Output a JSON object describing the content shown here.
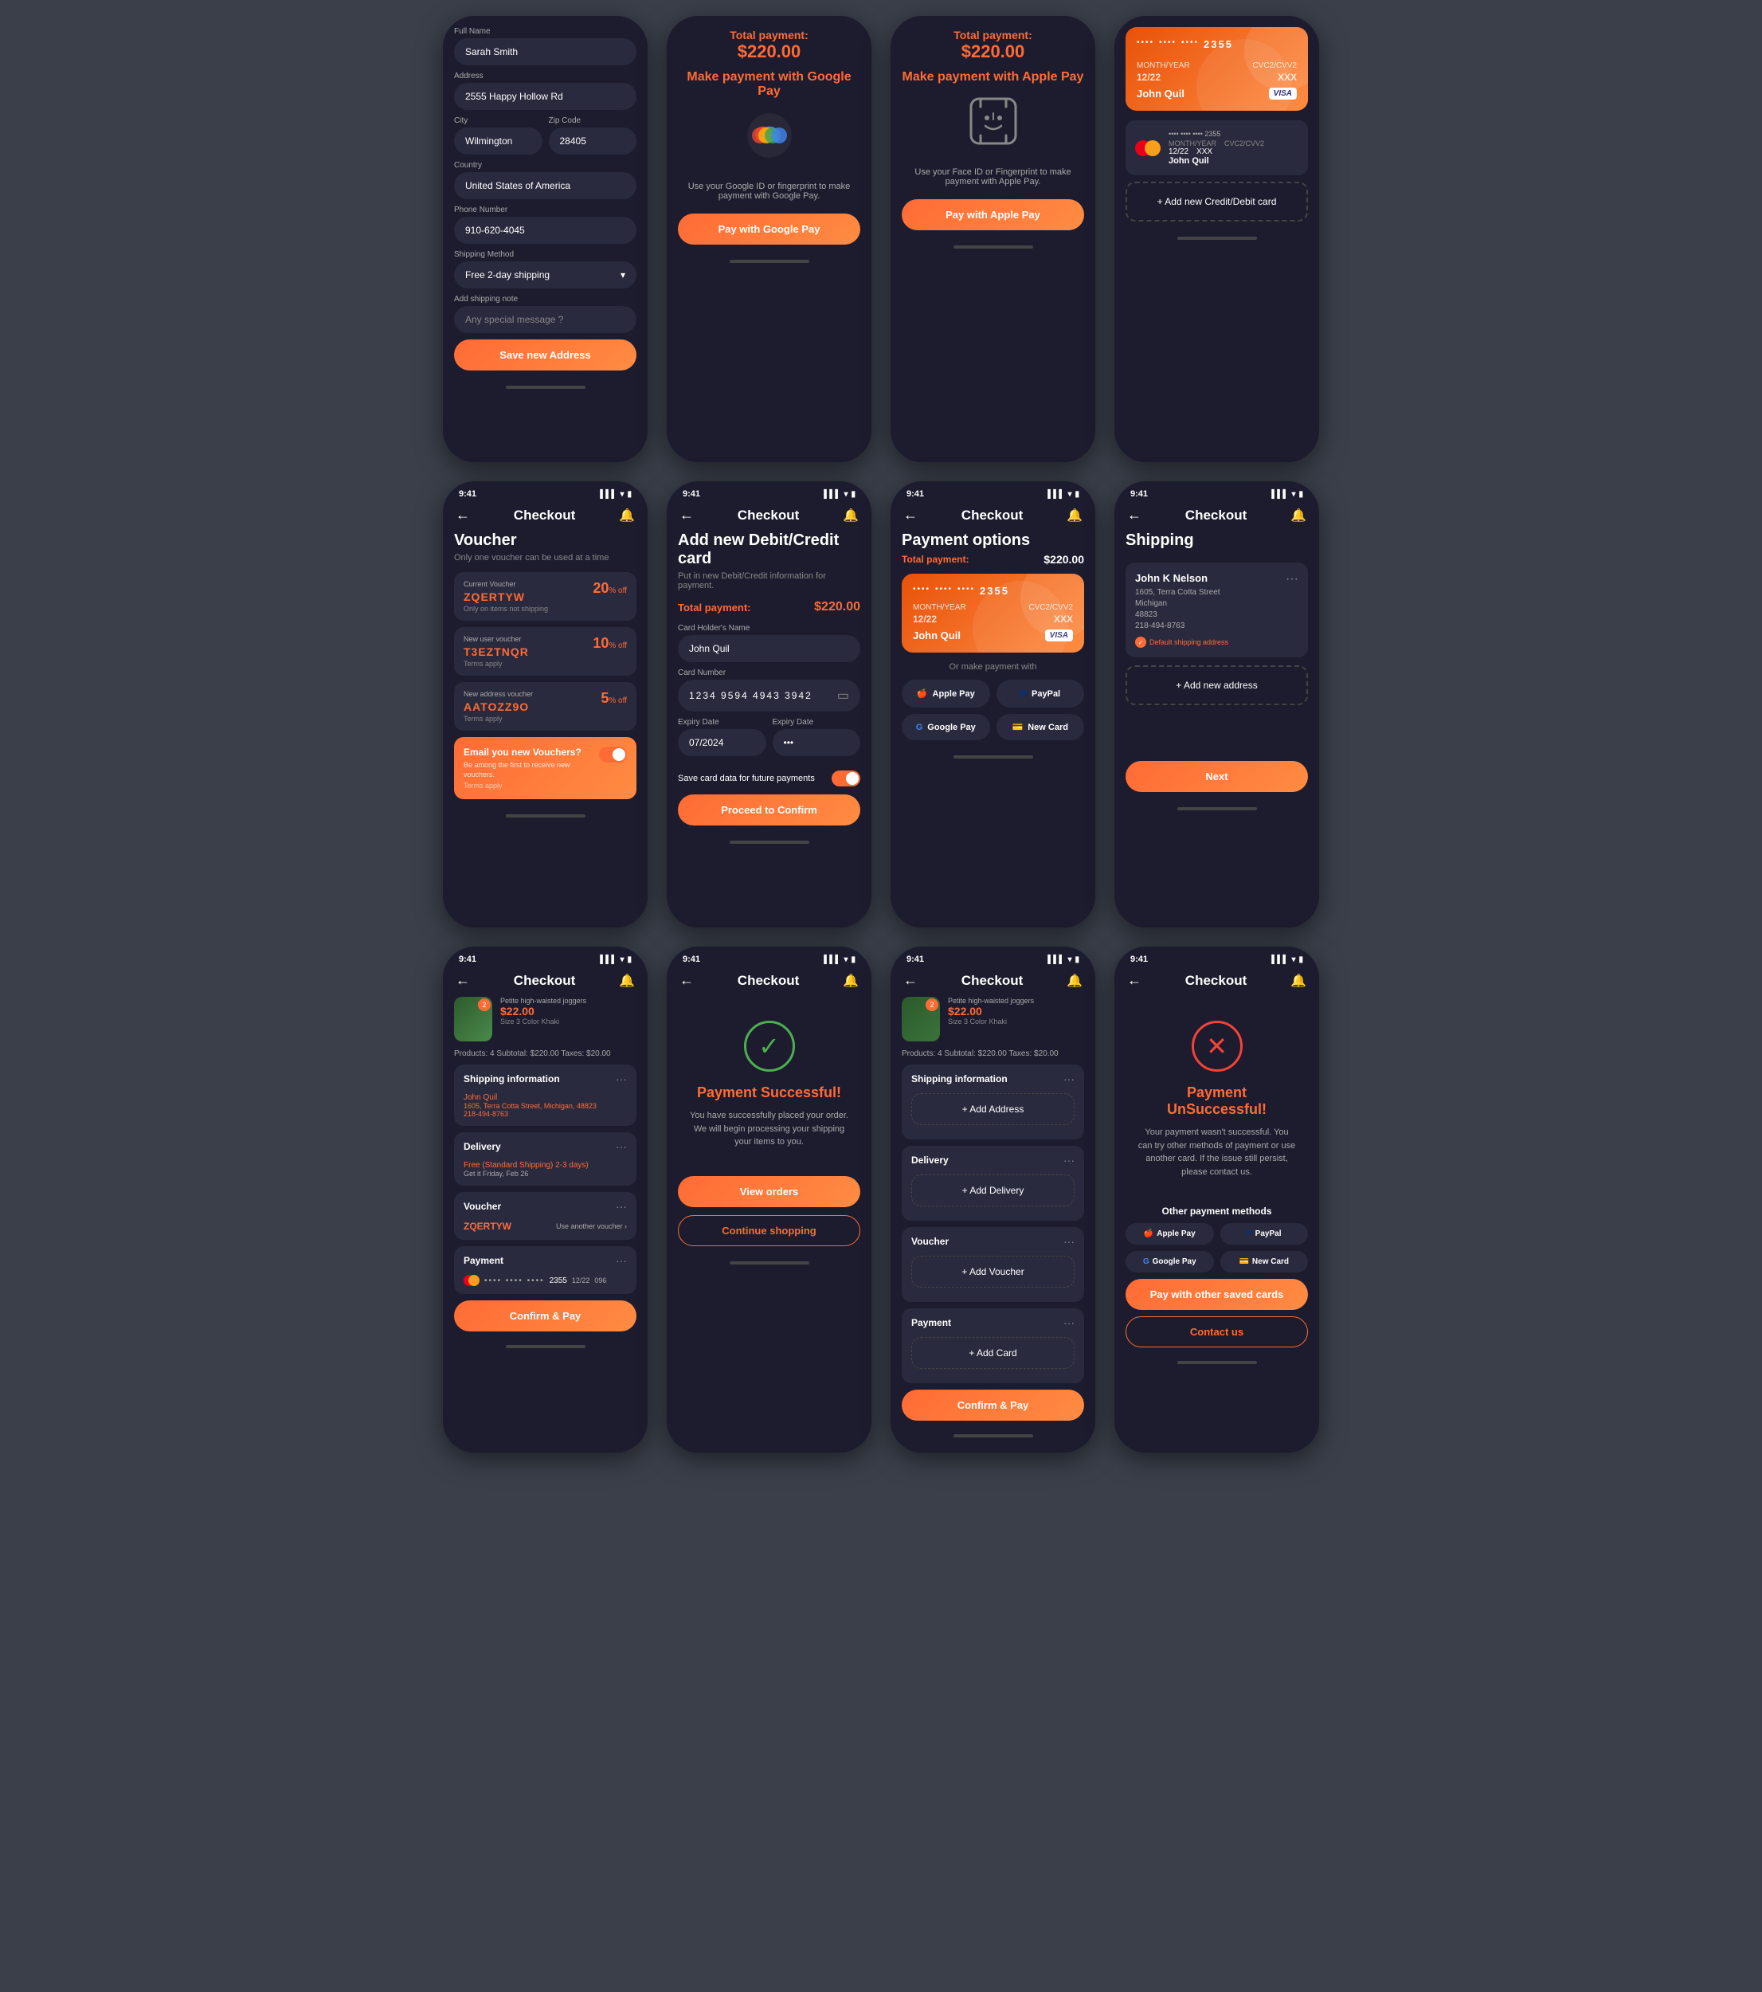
{
  "phones": [
    {
      "id": "shipping-address",
      "title": "",
      "hasStatusBar": false,
      "hasNav": false,
      "type": "shipping-form"
    },
    {
      "id": "google-pay",
      "title": "",
      "hasStatusBar": false,
      "hasNav": false,
      "type": "google-pay"
    },
    {
      "id": "apple-pay",
      "title": "",
      "hasStatusBar": false,
      "hasNav": false,
      "type": "apple-pay"
    },
    {
      "id": "saved-cards",
      "title": "",
      "hasStatusBar": false,
      "hasNav": false,
      "type": "saved-cards"
    },
    {
      "id": "voucher",
      "title": "Checkout",
      "hasStatusBar": true,
      "hasNav": true,
      "type": "voucher"
    },
    {
      "id": "add-card",
      "title": "Checkout",
      "hasStatusBar": true,
      "hasNav": true,
      "type": "add-card"
    },
    {
      "id": "payment-options",
      "title": "Checkout",
      "hasStatusBar": true,
      "hasNav": true,
      "type": "payment-options"
    },
    {
      "id": "shipping",
      "title": "Checkout",
      "hasStatusBar": true,
      "hasNav": true,
      "type": "shipping-list"
    },
    {
      "id": "order-summary",
      "title": "Checkout",
      "hasStatusBar": true,
      "hasNav": true,
      "type": "order-summary"
    },
    {
      "id": "payment-success",
      "title": "Checkout",
      "hasStatusBar": true,
      "hasNav": true,
      "type": "payment-success"
    },
    {
      "id": "order-empty",
      "title": "Checkout",
      "hasStatusBar": true,
      "hasNav": true,
      "type": "order-empty"
    },
    {
      "id": "payment-fail",
      "title": "Checkout",
      "hasStatusBar": true,
      "hasNav": true,
      "type": "payment-fail"
    }
  ],
  "statusBar": {
    "time": "9:41",
    "signal": "▌▌▌",
    "wifi": "WiFi",
    "battery": "🔋"
  },
  "shippingForm": {
    "fullNameLabel": "Full Name",
    "fullNameValue": "Sarah Smith",
    "addressLabel": "Address",
    "addressValue": "2555 Happy Hollow Rd",
    "cityLabel": "City",
    "cityValue": "Wilmington",
    "zipLabel": "Zip Code",
    "zipValue": "28405",
    "countryLabel": "Country",
    "countryValue": "United States of America",
    "phoneLabel": "Phone Number",
    "phoneValue": "910-620-4045",
    "shippingMethodLabel": "Shipping Method",
    "shippingMethodValue": "Free 2-day shipping",
    "shippingNoteLabel": "Add shipping note",
    "shippingNotePlaceholder": "Any special message ?",
    "saveButton": "Save new Address"
  },
  "googlePay": {
    "totalLabel": "Total payment:",
    "totalAmount": "$220.00",
    "makePaymentTitle": "Make payment with Google Pay",
    "description": "Use your Google ID or fingerprint to make payment with Google Pay.",
    "buttonLabel": "Pay with Google Pay"
  },
  "applePay": {
    "totalLabel": "Total payment:",
    "totalAmount": "$220.00",
    "makePaymentTitle": "Make payment with Apple Pay",
    "description": "Use your Face ID or Fingerprint to make payment with Apple Pay.",
    "buttonLabel": "Pay with Apple Pay"
  },
  "savedCards": {
    "visaCard": {
      "dots1": "••••",
      "dots2": "••••",
      "dots3": "••••",
      "number": "2355",
      "monthYear": "12/22",
      "cvv": "XXX",
      "name": "John Quil",
      "brand": "VISA"
    },
    "mastercardCard": {
      "dots1": "••••",
      "dots2": "••••",
      "dots3": "••••",
      "number": "2355",
      "monthYear": "12/22",
      "cvv": "XXX",
      "name": "John Quil"
    },
    "addNewLabel": "+ Add new Credit/Debit card"
  },
  "voucher": {
    "title": "Voucher",
    "subtitle": "Only one voucher can be used at a time",
    "vouchers": [
      {
        "label": "Current Voucher",
        "code": "ZQERTYW",
        "discount": "20",
        "terms": "Only on items not shipping"
      },
      {
        "label": "New user voucher",
        "code": "T3EZTNQR",
        "discount": "10",
        "terms": "Terms apply"
      },
      {
        "label": "New address voucher",
        "code": "AATOZZ9O",
        "discount": "5",
        "terms": "Terms apply"
      }
    ],
    "emailVoucher": {
      "title": "Email you new Vouchers?",
      "text": "Be among the first to receive new vouchers.",
      "termsNote": "Terms apply"
    }
  },
  "addCard": {
    "title": "Add new Debit/Credit card",
    "subtitle": "Put in new Debit/Credit information for payment.",
    "totalLabel": "Total payment:",
    "totalAmount": "$220.00",
    "cardHolderLabel": "Card Holder's Name",
    "cardHolderValue": "John Quil",
    "cardNumberLabel": "Card Number",
    "cardNumberValue": "1234   9594   4943   3942",
    "expiryDateLabel": "Expiry Date",
    "expiryDateValue": "07/2024",
    "expiryDate2Label": "Expiry Date",
    "expiryDate2Value": "•••",
    "saveCardLabel": "Save card data for future payments",
    "proceedButton": "Proceed to Confirm"
  },
  "paymentOptions": {
    "title": "Payment options",
    "totalLabel": "Total payment:",
    "totalAmount": "$220.00",
    "card": {
      "dots1": "••••",
      "dots2": "••••",
      "dots3": "••••",
      "number": "2355",
      "monthYear": "12/22",
      "cvv": "XXX",
      "name": "John Quil",
      "brand": "VISA"
    },
    "orLabel": "Or make payment with",
    "options": [
      {
        "label": "Apple Pay",
        "icon": "🍎"
      },
      {
        "label": "PayPal",
        "icon": "🅿"
      },
      {
        "label": "Google Pay",
        "icon": "G"
      },
      {
        "label": "New Card",
        "icon": "💳"
      }
    ]
  },
  "shippingList": {
    "title": "Shipping",
    "address": {
      "name": "John K Nelson",
      "street": "1605, Terra Cotta Street",
      "state": "Michigan",
      "zip": "48823",
      "phone": "218-494-8763",
      "isDefault": true,
      "defaultLabel": "Default shipping address"
    },
    "addLabel": "+ Add new address",
    "nextButton": "Next"
  },
  "orderSummary": {
    "product": {
      "name": "Petite high-waisted joggers",
      "price": "$22.00",
      "size": "3",
      "color": "Khaki",
      "quantity": "2"
    },
    "totals": "Products: 4   Subtotal: $220.00   Taxes: $20.00",
    "shipping": {
      "label": "Shipping information",
      "name": "John Quil",
      "street": "1605, Terra Cotta Street, Michigan, 48823",
      "phone": "218-494-8763"
    },
    "delivery": {
      "label": "Delivery",
      "type": "Free (Standard Shipping) 2-3 days)",
      "date": "Get it Friday, Feb 26"
    },
    "voucher": {
      "label": "Voucher",
      "code": "ZQERTYW",
      "changeLabel": "Use another voucher ›"
    },
    "payment": {
      "label": "Payment",
      "dots": "••••   ••••   ••••",
      "number": "2355",
      "month": "12/22",
      "cvv": "096"
    },
    "confirmButton": "Confirm & Pay"
  },
  "paymentSuccess": {
    "title": "Payment Successful!",
    "text": "You have successfully placed your order. We will begin processing your shipping your items to you.",
    "viewOrdersButton": "View orders",
    "continueButton": "Continue shopping"
  },
  "orderEmpty": {
    "product": {
      "name": "Petite high-waisted joggers",
      "price": "$22.00",
      "size": "3",
      "color": "Khaki",
      "quantity": "2"
    },
    "totals": "Products: 4   Subtotal: $220.00   Taxes: $20.00",
    "addAddress": "+ Add Address",
    "addDelivery": "+ Add Delivery",
    "addVoucher": "+ Add Voucher",
    "addCard": "+ Add Card",
    "confirmButton": "Confirm & Pay"
  },
  "paymentFail": {
    "title": "Payment UnSuccessful!",
    "text": "Your payment wasn't successful. You can try other methods of payment or use another card. If the issue still persist, please contact us.",
    "otherLabel": "Other payment methods",
    "methods": [
      {
        "label": "Apple Pay",
        "icon": "🍎"
      },
      {
        "label": "PayPal",
        "icon": "🅿"
      },
      {
        "label": "Google Pay",
        "icon": "G"
      },
      {
        "label": "New Card",
        "icon": "💳"
      }
    ],
    "savedCardsButton": "Pay with other saved cards",
    "contactButton": "Contact us"
  }
}
